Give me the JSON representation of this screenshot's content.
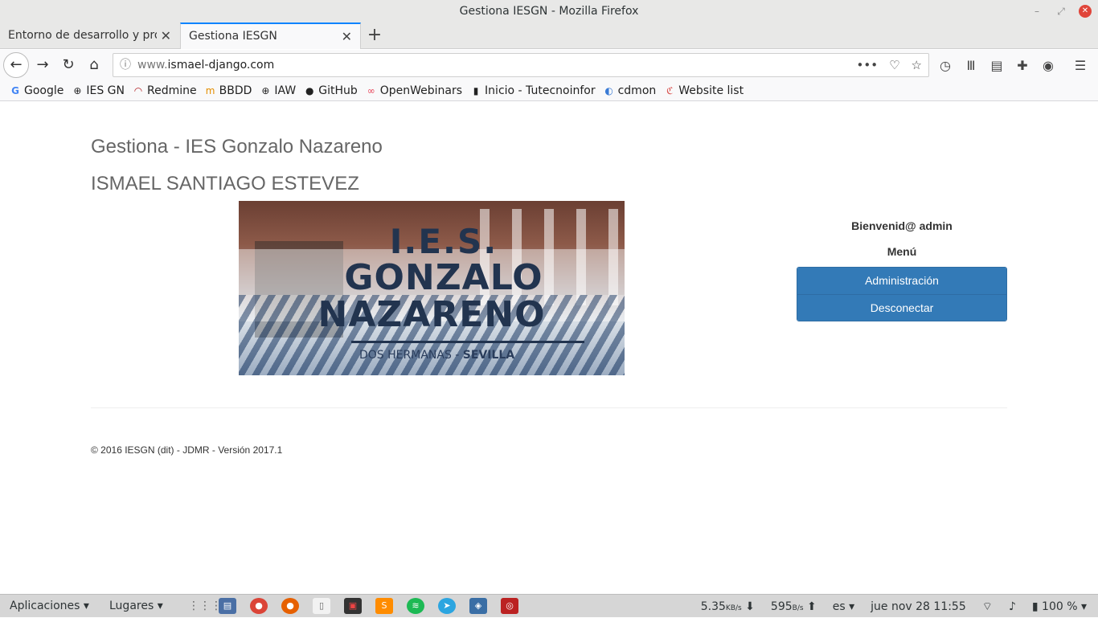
{
  "window": {
    "title": "Gestiona IESGN - Mozilla Firefox"
  },
  "tabs": [
    {
      "label": "Entorno de desarrollo y prod"
    },
    {
      "label": "Gestiona IESGN"
    }
  ],
  "urlbar": {
    "prefix": "www.",
    "domain": "ismael-django.com"
  },
  "bookmarks": [
    {
      "label": "Google",
      "icon": "google-icon"
    },
    {
      "label": "IES GN",
      "icon": "globe-icon"
    },
    {
      "label": "Redmine",
      "icon": "redmine-icon"
    },
    {
      "label": "BBDD",
      "icon": "bbdd-icon"
    },
    {
      "label": "IAW",
      "icon": "globe-icon"
    },
    {
      "label": "GitHub",
      "icon": "github-icon"
    },
    {
      "label": "OpenWebinars",
      "icon": "openwebinars-icon"
    },
    {
      "label": "Inicio - Tutecnoinfor",
      "icon": "book-icon"
    },
    {
      "label": "cdmon",
      "icon": "cdmon-icon"
    },
    {
      "label": "Website list",
      "icon": "website-list-icon"
    }
  ],
  "page": {
    "site_title": "Gestiona - IES Gonzalo Nazareno",
    "user_name": "ISMAEL SANTIAGO ESTEVEZ",
    "banner": {
      "line1": "I.E.S.",
      "line2": "GONZALO",
      "line3": "NAZARENO",
      "sub_town": "DOS HERMANAS - ",
      "sub_city": "SEVILLA"
    },
    "welcome": "Bienvenid@ admin",
    "menu_title": "Menú",
    "menu_items": [
      "Administración",
      "Desconectar"
    ],
    "footer": "© 2016 IESGN (dit) - JDMR - Versión 2017.1"
  },
  "panel": {
    "apps": "Aplicaciones ▾",
    "places": "Lugares ▾",
    "net_down": "5.35",
    "net_down_unit": "KB/s",
    "net_up": "595",
    "net_up_unit": "B/s",
    "keyboard": "es ▾",
    "clock": "jue nov 28  11:55",
    "battery": "100 % ▾"
  }
}
